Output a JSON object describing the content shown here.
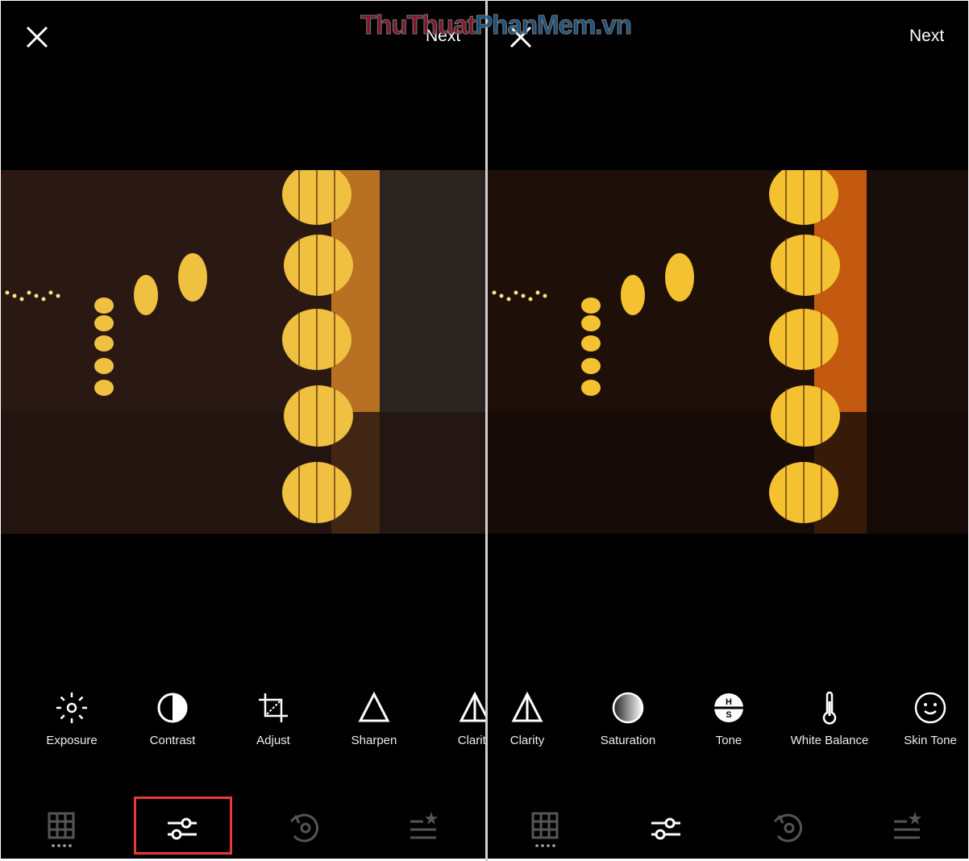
{
  "watermark": {
    "text_a": "ThuThuat",
    "text_b": "PhanMem",
    "text_c": ".vn",
    "color_a": "#8b1a2e",
    "color_b": "#1f5a8a"
  },
  "left": {
    "next_label": "Next",
    "tools": [
      {
        "label": "Exposure",
        "icon": "sun-icon"
      },
      {
        "label": "Contrast",
        "icon": "half-circle-icon"
      },
      {
        "label": "Adjust",
        "icon": "crop-rotate-icon"
      },
      {
        "label": "Sharpen",
        "icon": "triangle-icon"
      },
      {
        "label": "Clarity",
        "icon": "split-triangle-icon"
      }
    ],
    "nav": [
      {
        "icon": "grid-icon",
        "active": false
      },
      {
        "icon": "sliders-icon",
        "active": true,
        "highlighted": true
      },
      {
        "icon": "history-icon",
        "active": false
      },
      {
        "icon": "recipe-star-icon",
        "active": false
      }
    ]
  },
  "right": {
    "next_label": "Next",
    "tools": [
      {
        "label": "Clarity",
        "icon": "split-triangle-icon"
      },
      {
        "label": "Saturation",
        "icon": "gradient-circle-icon"
      },
      {
        "label": "Tone",
        "icon": "hs-circle-icon"
      },
      {
        "label": "White Balance",
        "icon": "thermometer-icon"
      },
      {
        "label": "Skin Tone",
        "icon": "face-icon"
      }
    ],
    "nav": [
      {
        "icon": "grid-icon",
        "active": false
      },
      {
        "icon": "sliders-icon",
        "active": true
      },
      {
        "icon": "history-icon",
        "active": false
      },
      {
        "icon": "recipe-star-icon",
        "active": false
      }
    ]
  },
  "colors": {
    "highlight": "#e8393b",
    "inactive": "#555555"
  }
}
